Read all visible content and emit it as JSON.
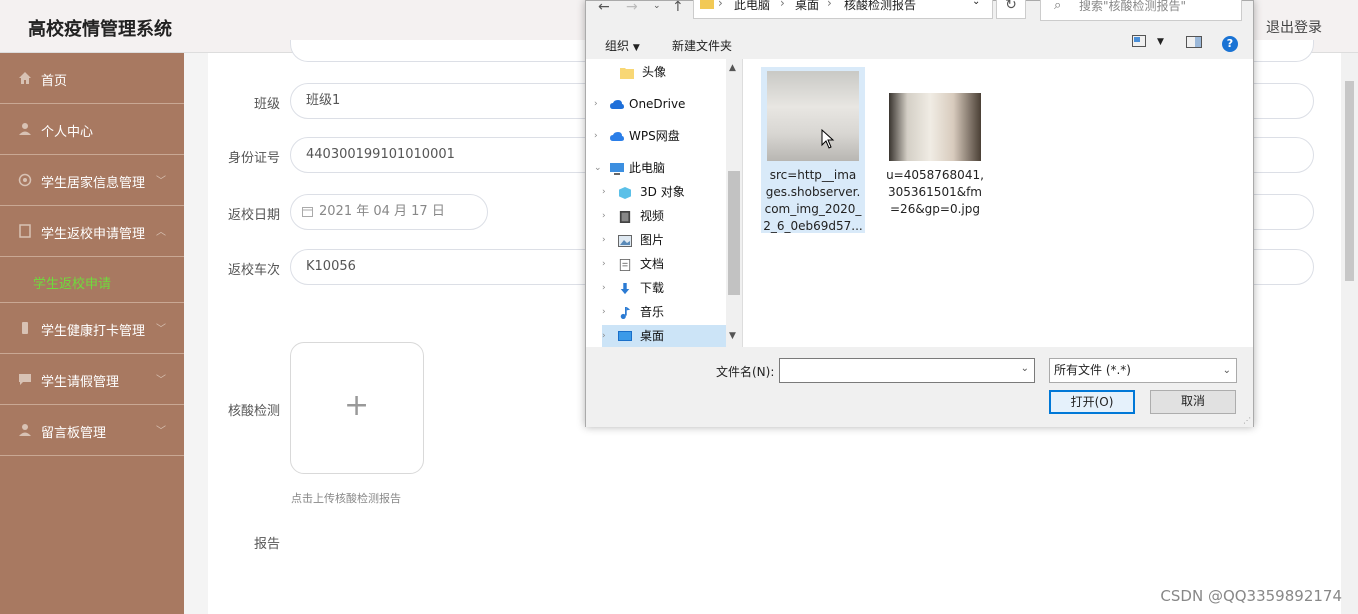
{
  "header": {
    "title": "高校疫情管理系统",
    "logout": "退出登录"
  },
  "sidebar": {
    "items": [
      {
        "label": "首页",
        "icon": "home-icon"
      },
      {
        "label": "个人中心",
        "icon": "user-icon"
      },
      {
        "label": "学生居家信息管理",
        "icon": "settings-icon"
      },
      {
        "label": "学生返校申请管理",
        "icon": "document-icon"
      },
      {
        "label": "学生返校申请",
        "sub": true
      },
      {
        "label": "学生健康打卡管理",
        "icon": "phone-icon"
      },
      {
        "label": "学生请假管理",
        "icon": "chat-icon"
      },
      {
        "label": "留言板管理",
        "icon": "user-icon"
      }
    ]
  },
  "form": {
    "class_label": "班级",
    "class_value": "班级1",
    "id_label": "身份证号",
    "id_value": "440300199101010001",
    "date_label": "返校日期",
    "date_value": "2021 年 04 月 17 日",
    "train_label": "返校车次",
    "train_value": "K10056",
    "nucleic_label": "核酸检测",
    "upload_hint": "点击上传核酸检测报告",
    "report_label": "报告"
  },
  "dialog": {
    "breadcrumb": [
      "此电脑",
      "桌面",
      "核酸检测报告"
    ],
    "search_placeholder": "搜索\"核酸检测报告\"",
    "toolbar": {
      "organize": "组织",
      "new_folder": "新建文件夹"
    },
    "nav_tree": [
      {
        "label": "头像",
        "icon": "folder-icon"
      },
      {
        "label": "OneDrive",
        "icon": "cloud-icon"
      },
      {
        "label": "WPS网盘",
        "icon": "cloud-icon"
      },
      {
        "label": "此电脑",
        "icon": "computer-icon"
      },
      {
        "label": "3D 对象",
        "icon": "cube-icon"
      },
      {
        "label": "视频",
        "icon": "video-icon"
      },
      {
        "label": "图片",
        "icon": "picture-icon"
      },
      {
        "label": "文档",
        "icon": "document-icon"
      },
      {
        "label": "下载",
        "icon": "download-icon"
      },
      {
        "label": "音乐",
        "icon": "music-icon"
      },
      {
        "label": "桌面",
        "icon": "desktop-icon"
      }
    ],
    "files": [
      {
        "name": "src=http__images.shobserver.com_img_2020_2_6_0eb69d57...",
        "line1": "src=http__ima",
        "line2": "ges.shobserver.",
        "line3": "com_img_2020_",
        "line4": "2_6_0eb69d57..."
      },
      {
        "name": "u=4058768041,305361501&fm=26&gp=0.jpg",
        "line1": "u=4058768041,",
        "line2": "305361501&fm",
        "line3": "=26&gp=0.jpg"
      }
    ],
    "filename_label": "文件名(N):",
    "filename_value": "",
    "filetype": "所有文件 (*.*)",
    "open_button": "打开(O)",
    "cancel_button": "取消"
  },
  "watermark": "CSDN @QQ3359892174",
  "colors": {
    "sidebar": "#a87961",
    "submenu_active": "#6fdc3c",
    "accent": "#0078d7"
  }
}
